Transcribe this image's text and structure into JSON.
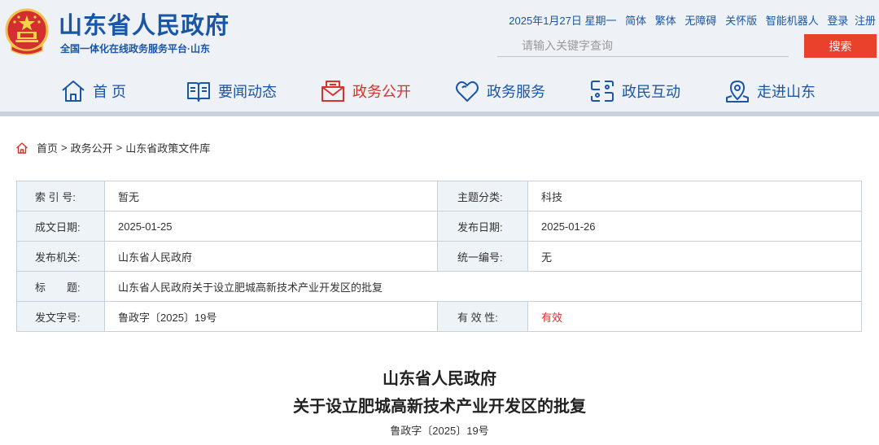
{
  "site": {
    "title": "山东省人民政府",
    "subtitle": "全国一体化在线政务服务平台·山东"
  },
  "topbar": {
    "date": "2025年1月27日 星期一",
    "links": [
      "简体",
      "繁体",
      "无障碍",
      "关怀版",
      "智能机器人",
      "登录",
      "注册"
    ]
  },
  "search": {
    "placeholder": "请输入关键字查询",
    "button": "搜索"
  },
  "nav": {
    "items": [
      {
        "label": "首 页",
        "icon": "home-icon"
      },
      {
        "label": "要闻动态",
        "icon": "book-icon"
      },
      {
        "label": "政务公开",
        "icon": "mailbox-icon",
        "active": true
      },
      {
        "label": "政务服务",
        "icon": "heart-icon"
      },
      {
        "label": "政民互动",
        "icon": "interaction-icon"
      },
      {
        "label": "走进山东",
        "icon": "location-pin-icon"
      }
    ]
  },
  "breadcrumb": [
    "首页",
    "政务公开",
    "山东省政策文件库"
  ],
  "meta": {
    "index_label": "索 引 号:",
    "index_value": "暂无",
    "topic_label": "主题分类:",
    "topic_value": "科技",
    "created_label": "成文日期:",
    "created_value": "2025-01-25",
    "published_label": "发布日期:",
    "published_value": "2025-01-26",
    "issuer_label": "发布机关:",
    "issuer_value": "山东省人民政府",
    "serial_label": "统一编号:",
    "serial_value": "无",
    "title_label": "标　　题:",
    "title_value": "山东省人民政府关于设立肥城高新技术产业开发区的批复",
    "docno_label": "发文字号:",
    "docno_value": "鲁政字〔2025〕19号",
    "validity_label": "有 效 性:",
    "validity_value": "有效"
  },
  "document": {
    "title_line1": "山东省人民政府",
    "title_line2": "关于设立肥城高新技术产业开发区的批复",
    "doc_number": "鲁政字〔2025〕19号"
  },
  "colors": {
    "brand_blue": "#1a56a8",
    "accent_red": "#d7322b",
    "search_red": "#e8412c"
  }
}
